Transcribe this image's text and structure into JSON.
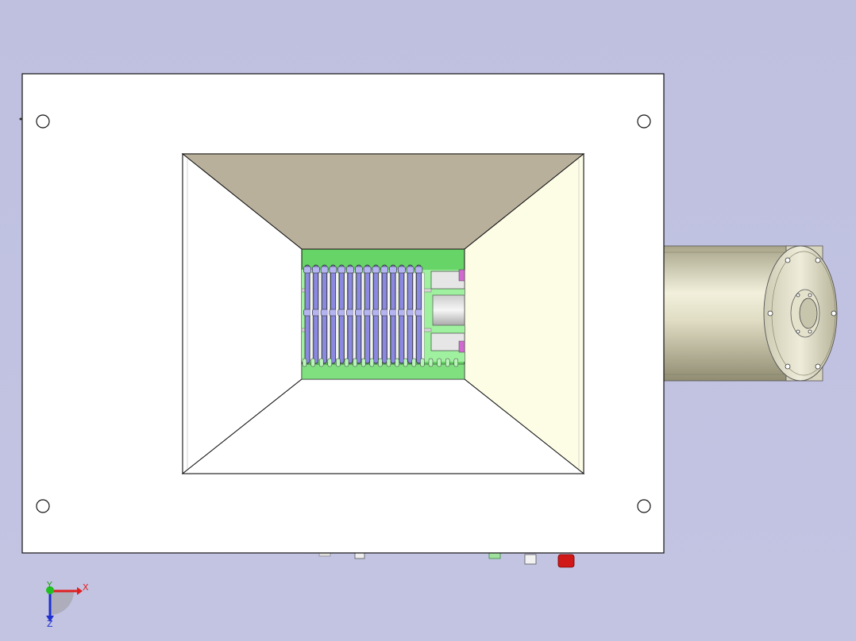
{
  "viewport": {
    "background": "#c0c0e0"
  },
  "model": {
    "plate_color": "#ffffff",
    "hopper_top_color": "#b9b09c",
    "hopper_side_color": "#fdfde6",
    "chamber_color": "#66d466",
    "blade_color": "#8a88e0",
    "motor_color": "#d6d3bb",
    "mounting_holes": 4,
    "blade_count": 14
  },
  "triad": {
    "x_label": "X",
    "y_label": "Y",
    "z_label": "Z",
    "x_color": "#e02020",
    "y_color": "#20c020",
    "z_color": "#2030d0"
  }
}
